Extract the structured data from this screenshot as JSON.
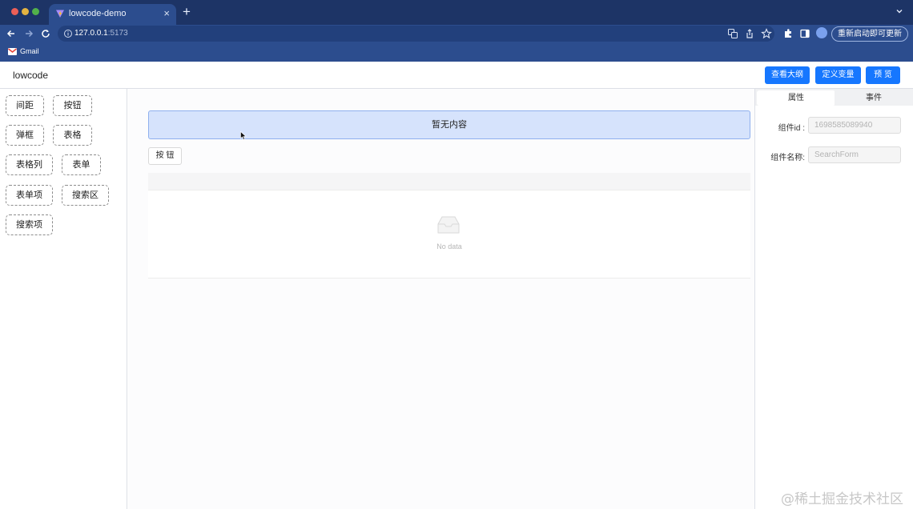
{
  "browser": {
    "tab_title": "lowcode-demo",
    "tab_close": "×",
    "new_tab": "+",
    "url_host": "127.0.0.1",
    "url_port": ":5173",
    "relaunch_label": "重新启动即可更新",
    "bookmark_gmail": "Gmail"
  },
  "header": {
    "brand": "lowcode",
    "outline_btn": "查看大纲",
    "variables_btn": "定义变量",
    "preview_btn": "预 览"
  },
  "palette": {
    "items": [
      "间距",
      "按钮",
      "弹框",
      "表格",
      "表格列",
      "表单",
      "表单项",
      "搜索区",
      "搜索项"
    ]
  },
  "canvas": {
    "drop_zone_text": "暂无内容",
    "button_label": "按 钮",
    "empty_text": "No data"
  },
  "props": {
    "tab_attributes": "属性",
    "tab_events": "事件",
    "id_label": "组件id :",
    "id_value": "1698585089940",
    "name_label": "组件名称:",
    "name_value": "SearchForm"
  },
  "watermark": "@稀土掘金技术社区",
  "colors": {
    "chrome_dark": "#1d3466",
    "chrome": "#2c4d8e",
    "primary": "#1677ff",
    "drop_zone": "#d6e3fc"
  }
}
